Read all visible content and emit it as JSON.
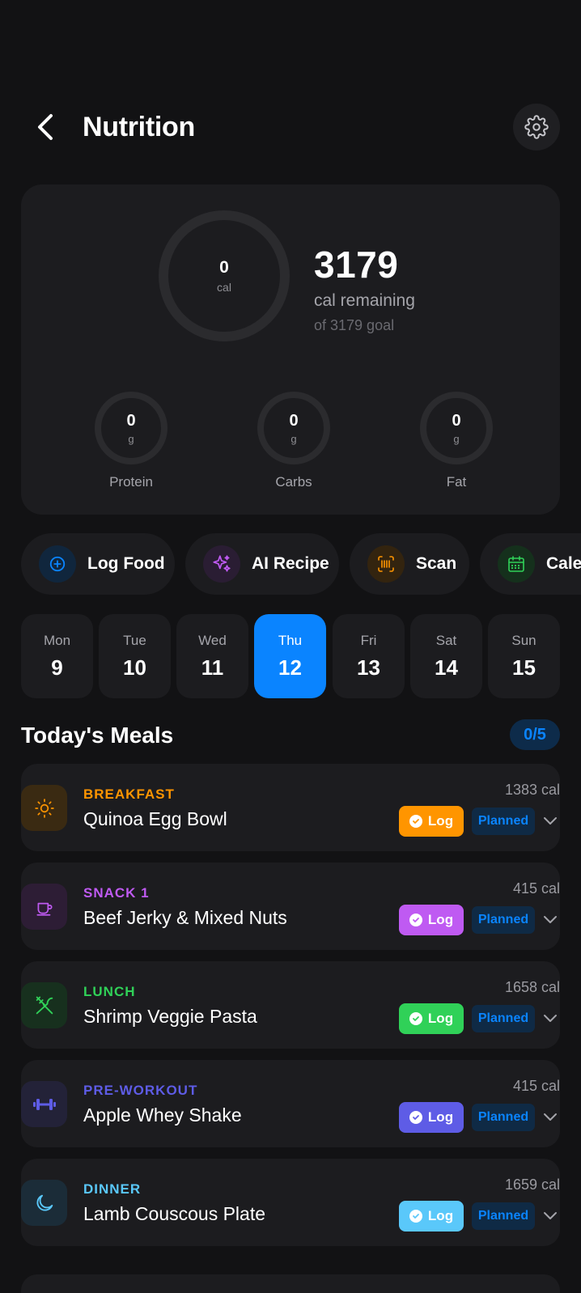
{
  "header": {
    "title": "Nutrition"
  },
  "summary": {
    "calories_consumed": "0",
    "calories_unit": "cal",
    "remaining": "3179",
    "remaining_label": "cal remaining",
    "goal_label": "of 3179 goal",
    "macros": [
      {
        "value": "0",
        "unit": "g",
        "label": "Protein"
      },
      {
        "value": "0",
        "unit": "g",
        "label": "Carbs"
      },
      {
        "value": "0",
        "unit": "g",
        "label": "Fat"
      }
    ]
  },
  "actions": [
    {
      "label": "Log Food",
      "icon": "plus-circle-icon",
      "color": "#0a84ff"
    },
    {
      "label": "AI Recipe",
      "icon": "sparkles-icon",
      "color": "#bf5af2"
    },
    {
      "label": "Scan",
      "icon": "barcode-icon",
      "color": "#ff9500"
    },
    {
      "label": "Cale",
      "icon": "calendar-icon",
      "color": "#30d158"
    }
  ],
  "week": [
    {
      "name": "Mon",
      "num": "9"
    },
    {
      "name": "Tue",
      "num": "10"
    },
    {
      "name": "Wed",
      "num": "11"
    },
    {
      "name": "Thu",
      "num": "12",
      "active": true
    },
    {
      "name": "Fri",
      "num": "13"
    },
    {
      "name": "Sat",
      "num": "14"
    },
    {
      "name": "Sun",
      "num": "15"
    }
  ],
  "meals_section": {
    "title": "Today's Meals",
    "count": "0/5"
  },
  "meals": [
    {
      "type": "BREAKFAST",
      "name": "Quinoa Egg Bowl",
      "calories": "1383 cal",
      "log_label": "Log",
      "status": "Planned",
      "color": "#ff9500",
      "icon": "sun-icon"
    },
    {
      "type": "SNACK 1",
      "name": "Beef Jerky & Mixed Nuts",
      "calories": "415 cal",
      "log_label": "Log",
      "status": "Planned",
      "color": "#bf5af2",
      "icon": "coffee-cup-icon"
    },
    {
      "type": "LUNCH",
      "name": "Shrimp Veggie Pasta",
      "calories": "1658 cal",
      "log_label": "Log",
      "status": "Planned",
      "color": "#30d158",
      "icon": "utensils-icon"
    },
    {
      "type": "PRE-WORKOUT",
      "name": "Apple Whey Shake",
      "calories": "415 cal",
      "log_label": "Log",
      "status": "Planned",
      "color": "#5e5ce6",
      "icon": "dumbbell-icon"
    },
    {
      "type": "DINNER",
      "name": "Lamb Couscous Plate",
      "calories": "1659 cal",
      "log_label": "Log",
      "status": "Planned",
      "color": "#5ac8fa",
      "icon": "moon-icon"
    }
  ]
}
